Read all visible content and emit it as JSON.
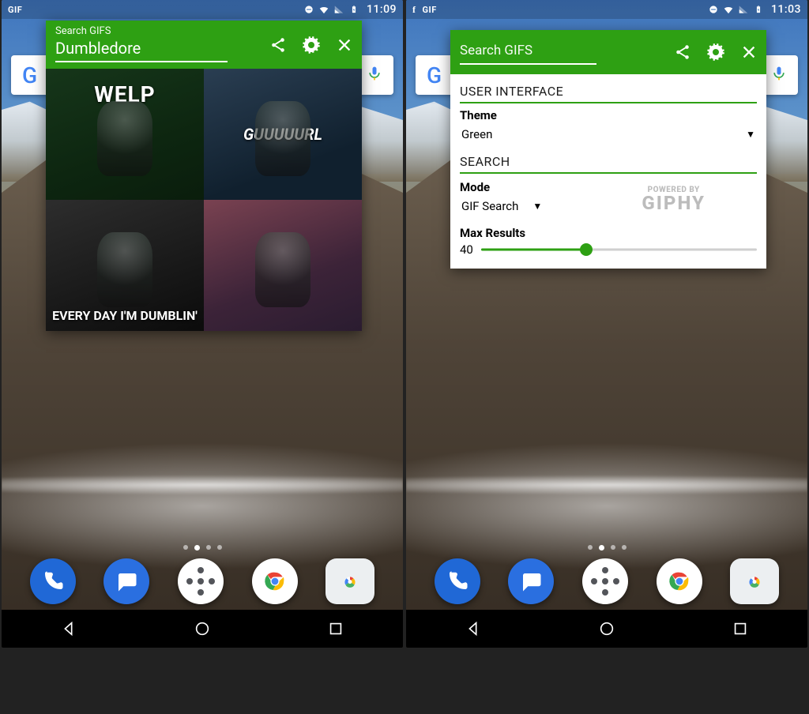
{
  "screens": {
    "left": {
      "status": {
        "app_label": "GIF",
        "time": "11:09"
      },
      "popup": {
        "placeholder": "Search GIFS",
        "query": "Dumbledore",
        "results": [
          {
            "caption": "WELP",
            "style": "cap-top",
            "bg": "g1"
          },
          {
            "caption": "GUUUUURL",
            "style": "cap-it",
            "bg": "g2"
          },
          {
            "caption": "EVERY DAY I'M DUMBLIN'",
            "style": "cap-bot",
            "bg": "g3"
          },
          {
            "caption": "",
            "style": "",
            "bg": "g4"
          }
        ]
      }
    },
    "right": {
      "status": {
        "app1": "f",
        "app_label": "GIF",
        "time": "11:03"
      },
      "popup": {
        "placeholder": "Search GIFS",
        "settings": {
          "section_ui": "USER INTERFACE",
          "theme_label": "Theme",
          "theme_value": "Green",
          "section_search": "SEARCH",
          "mode_label": "Mode",
          "mode_value": "GIF Search",
          "powered_small": "POWERED BY",
          "powered_big": "GIPHY",
          "max_label": "Max Results",
          "max_value": "40",
          "slider_percent": 38
        }
      }
    }
  },
  "dock": {
    "apps": [
      "phone",
      "messages",
      "app-drawer",
      "chrome",
      "camera"
    ]
  }
}
